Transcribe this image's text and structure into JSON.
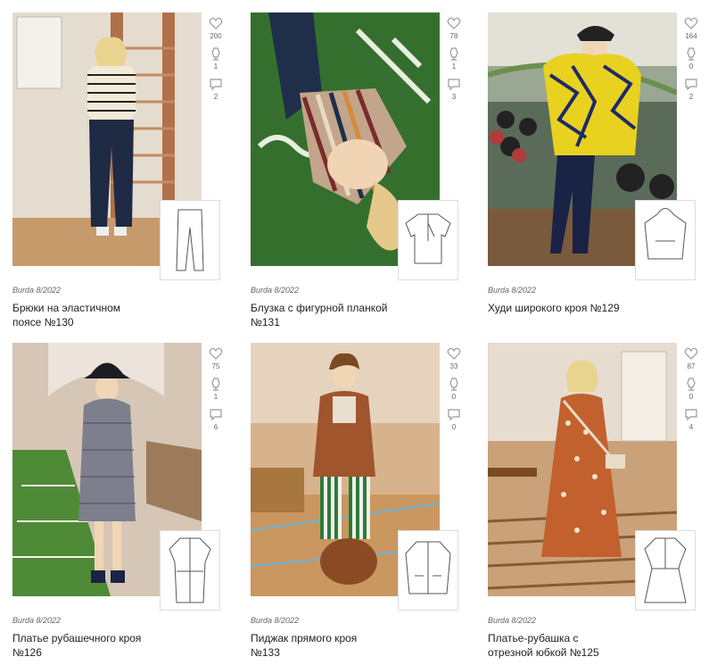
{
  "cards": [
    {
      "magazine": "Burda 8/2022",
      "title_line1": "Брюки на эластичном",
      "title_line2": "поясе №130",
      "likes": "200",
      "saves": "1",
      "comments": "2",
      "colors": {
        "bg": "#d8cec0",
        "accent": "#1f2a44"
      }
    },
    {
      "magazine": "Burda 8/2022",
      "title_line1": "Блузка с фигурной планкой",
      "title_line2": "№131",
      "likes": "78",
      "saves": "1",
      "comments": "3",
      "colors": {
        "bg": "#2f6b2a",
        "accent": "#7a2b2b"
      }
    },
    {
      "magazine": "Burda 8/2022",
      "title_line1": "Худи широкого кроя №129",
      "title_line2": "",
      "likes": "164",
      "saves": "0",
      "comments": "2",
      "colors": {
        "bg": "#8a9a85",
        "accent": "#e8d21f"
      }
    },
    {
      "magazine": "Burda 8/2022",
      "title_line1": "Платье рубашечного кроя",
      "title_line2": "№126",
      "likes": "75",
      "saves": "1",
      "comments": "6",
      "colors": {
        "bg": "#c9b8a8",
        "accent": "#6e6e78"
      }
    },
    {
      "magazine": "Burda 8/2022",
      "title_line1": "Пиджак прямого кроя",
      "title_line2": "№133",
      "likes": "33",
      "saves": "0",
      "comments": "0",
      "colors": {
        "bg": "#c89a6a",
        "accent": "#a0552d"
      }
    },
    {
      "magazine": "Burda 8/2022",
      "title_line1": "Платье-рубашка с",
      "title_line2": "отрезной юбкой №125",
      "likes": "87",
      "saves": "0",
      "comments": "4",
      "colors": {
        "bg": "#b98a5e",
        "accent": "#c2612e"
      }
    }
  ]
}
